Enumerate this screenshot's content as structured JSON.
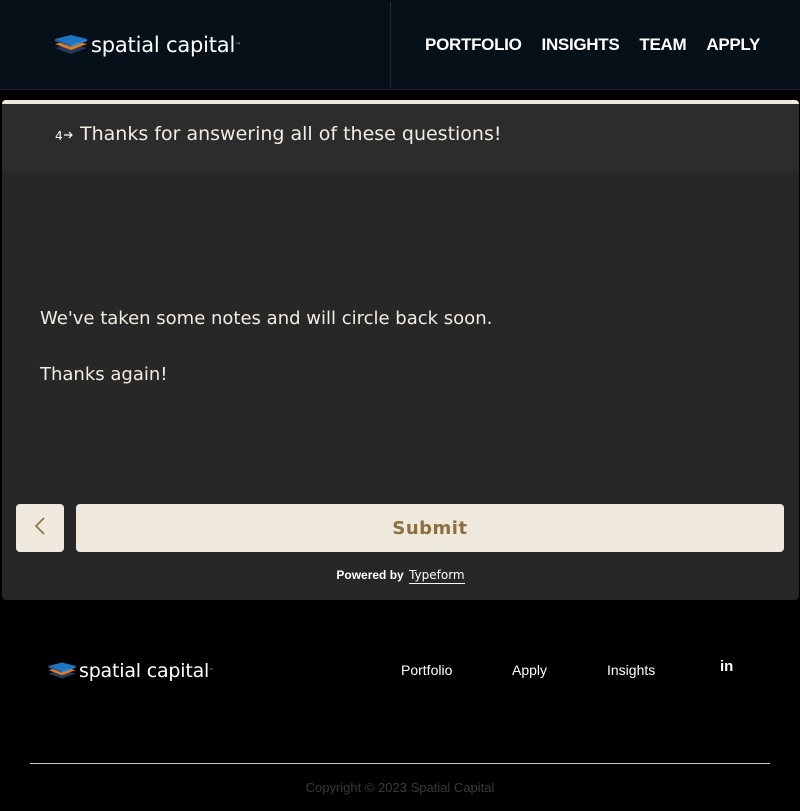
{
  "header": {
    "brand": "spatial capital",
    "brand_tm": "™",
    "nav": [
      "PORTFOLIO",
      "INSIGHTS",
      "TEAM",
      "APPLY"
    ]
  },
  "form": {
    "question_number": "4",
    "question_title": "Thanks for answering all of these questions!",
    "message_line1": "We've taken some notes and will circle back soon.",
    "message_line2": "Thanks again!",
    "submit_label": "Submit",
    "powered_by": "Powered by",
    "powered_brand": "Typeform"
  },
  "footer": {
    "brand": "spatial capital",
    "brand_tm": "™",
    "links": [
      "Portfolio",
      "Apply",
      "Insights"
    ],
    "linkedin": "in",
    "copyright": "Copyright © 2023 Spatial Capital"
  },
  "colors": {
    "header_bg": "#061019",
    "card_bg": "#272727",
    "button_bg": "#efe9dd",
    "submit_text": "#8b6f3e",
    "logo_blue": "#1f74c4",
    "logo_orange": "#e57a1f",
    "logo_navy": "#283a5c"
  },
  "icons": {
    "back": "chevron-left-icon",
    "arrow": "arrow-right-icon",
    "linkedin": "linkedin-icon",
    "logo": "stacked-layers-logo"
  }
}
